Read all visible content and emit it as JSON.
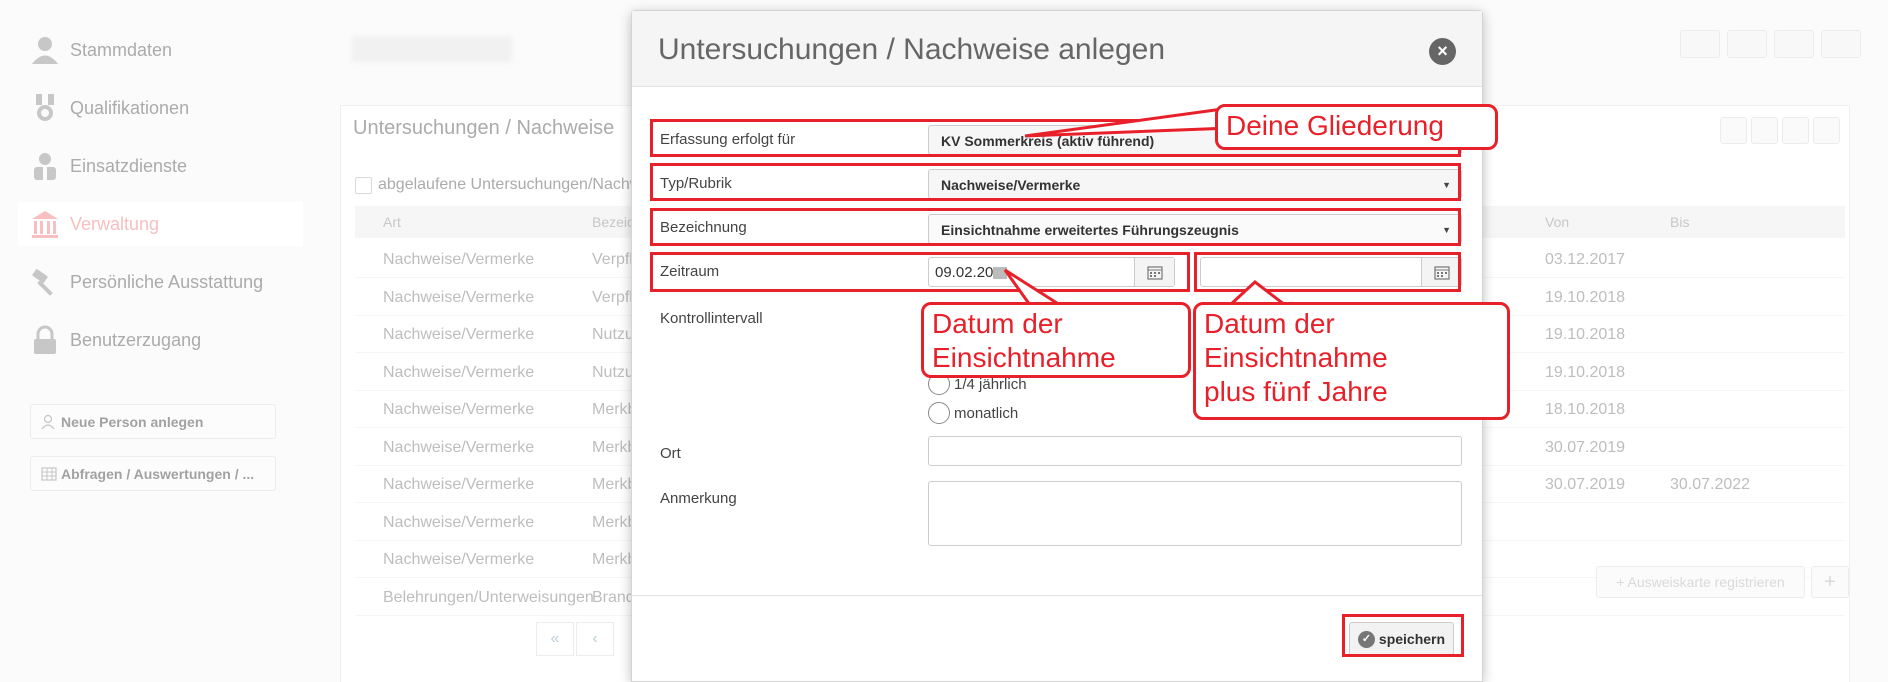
{
  "sidebar": {
    "items": [
      {
        "label": "Stammdaten",
        "icon": "person-icon"
      },
      {
        "label": "Qualifikationen",
        "icon": "medal-icon"
      },
      {
        "label": "Einsatzdienste",
        "icon": "worker-icon"
      },
      {
        "label": "Verwaltung",
        "icon": "building-icon",
        "active": true
      },
      {
        "label": "Persönliche Ausstattung",
        "icon": "hammer-icon"
      },
      {
        "label": "Benutzerzugang",
        "icon": "lock-icon"
      }
    ],
    "buttons": [
      {
        "label": "Neue Person anlegen",
        "icon": "add-person-icon"
      },
      {
        "label": "Abfragen / Auswertungen / ...",
        "icon": "table-icon"
      }
    ]
  },
  "panel": {
    "title": "Untersuchungen / Nachweise",
    "checkbox_label": "abgelaufene Untersuchungen/Nachwe",
    "columns": [
      "Art",
      "Bezeic",
      "Von",
      "Bis"
    ],
    "rows": [
      {
        "art": "Nachweise/Vermerke",
        "bez": "Verpfl",
        "von": "03.12.2017",
        "bis": ""
      },
      {
        "art": "Nachweise/Vermerke",
        "bez": "Verpfl",
        "von": "19.10.2018",
        "bis": ""
      },
      {
        "art": "Nachweise/Vermerke",
        "bez": "Nutzu",
        "von": "19.10.2018",
        "bis": ""
      },
      {
        "art": "Nachweise/Vermerke",
        "bez": "Nutzu",
        "von": "19.10.2018",
        "bis": ""
      },
      {
        "art": "Nachweise/Vermerke",
        "bez": "Merkb",
        "von": "18.10.2018",
        "bis": ""
      },
      {
        "art": "Nachweise/Vermerke",
        "bez": "Merkb",
        "von": "30.07.2019",
        "bis": ""
      },
      {
        "art": "Nachweise/Vermerke",
        "bez": "Merkb",
        "von": "30.07.2019",
        "bis": "30.07.2022"
      },
      {
        "art": "Nachweise/Vermerke",
        "bez": "Merkb",
        "von": "",
        "bis": ""
      },
      {
        "art": "Nachweise/Vermerke",
        "bez": "Merkb",
        "von": "",
        "bis": ""
      },
      {
        "art": "Belehrungen/Unterweisungen",
        "bez": "Brand",
        "von": "",
        "bis": ""
      }
    ],
    "pager": [
      "«",
      "‹"
    ],
    "register_button": "Ausweiskarte registrieren",
    "plus_button": "+"
  },
  "modal": {
    "title": "Untersuchungen / Nachweise anlegen",
    "close_label": "×",
    "fields": {
      "erfassung_label": "Erfassung erfolgt für",
      "erfassung_value": "KV Sommerkreis (aktiv führend)",
      "typ_label": "Typ/Rubrik",
      "typ_value": "Nachweise/Vermerke",
      "bezeichnung_label": "Bezeichnung",
      "bezeichnung_value": "Einsichtnahme erweitertes Führungszeugnis",
      "zeitraum_label": "Zeitraum",
      "zeitraum_from": "09.02.20",
      "zeitraum_to": "",
      "kontroll_label": "Kontrollintervall",
      "radio_partial": "1/4 jährlich",
      "radio_monthly": "monatlich",
      "ort_label": "Ort",
      "ort_value": "",
      "anmerkung_label": "Anmerkung",
      "anmerkung_value": ""
    },
    "save_label": "speichern"
  },
  "annotations": {
    "gliederung": "Deine Gliederung",
    "datum_line1": "Datum der",
    "datum_line2": "Einsichtnahme",
    "plus_line1": "Datum der",
    "plus_line2": "Einsichtnahme",
    "plus_line3": "plus fünf Jahre"
  },
  "colors": {
    "annotation_red": "#e8202a",
    "active_nav": "#e33333",
    "modal_header_bg": "#f5f5f5"
  }
}
